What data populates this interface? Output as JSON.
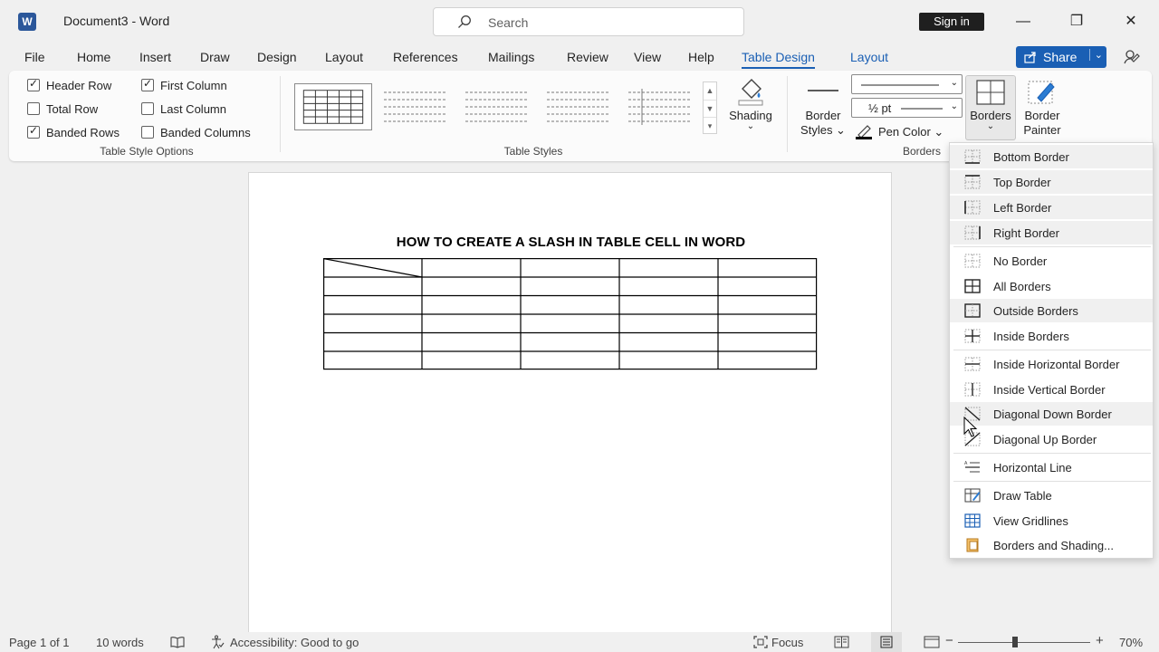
{
  "titlebar": {
    "app_icon": "W",
    "title": "Document3  -  Word",
    "search_placeholder": "Search",
    "sign_in": "Sign in",
    "minimize": "—",
    "restore": "❐",
    "close": "✕"
  },
  "tabs": [
    {
      "label": "File"
    },
    {
      "label": "Home"
    },
    {
      "label": "Insert"
    },
    {
      "label": "Draw"
    },
    {
      "label": "Design"
    },
    {
      "label": "Layout"
    },
    {
      "label": "References"
    },
    {
      "label": "Mailings"
    },
    {
      "label": "Review"
    },
    {
      "label": "View"
    },
    {
      "label": "Help"
    },
    {
      "label": "Table Design"
    },
    {
      "label": "Layout"
    }
  ],
  "share": {
    "label": "Share",
    "caret": "⌄"
  },
  "ribbon": {
    "style_options": {
      "header_row": "Header Row",
      "first_column": "First Column",
      "total_row": "Total Row",
      "last_column": "Last Column",
      "banded_rows": "Banded Rows",
      "banded_columns": "Banded Columns",
      "group_label": "Table Style Options"
    },
    "table_styles_label": "Table Styles",
    "shading": {
      "label": "Shading",
      "caret": "⌄"
    },
    "border_styles": {
      "line1": "Border",
      "line2": "Styles ⌄"
    },
    "pen_weight": "½ pt",
    "pen_color": "Pen Color ⌄",
    "borders_btn": {
      "label": "Borders",
      "caret": "⌄"
    },
    "border_painter": {
      "line1": "Border",
      "line2": "Painter"
    },
    "borders_group_label": "Borders"
  },
  "document": {
    "heading": "HOW TO CREATE A SLASH IN TABLE CELL IN WORD",
    "table": {
      "rows": 6,
      "cols": 5,
      "diagonal_cell": "row 1 col 1"
    }
  },
  "borders_menu": [
    {
      "label": "Bottom Border",
      "icon": "bottom-border-icon"
    },
    {
      "label": "Top Border",
      "icon": "top-border-icon"
    },
    {
      "label": "Left Border",
      "icon": "left-border-icon"
    },
    {
      "label": "Right Border",
      "icon": "right-border-icon"
    },
    {
      "label": "No Border",
      "icon": "no-border-icon"
    },
    {
      "label": "All Borders",
      "icon": "all-borders-icon"
    },
    {
      "label": "Outside Borders",
      "icon": "outside-borders-icon"
    },
    {
      "label": "Inside Borders",
      "icon": "inside-borders-icon"
    },
    {
      "label": "Inside Horizontal Border",
      "icon": "inside-horizontal-border-icon"
    },
    {
      "label": "Inside Vertical Border",
      "icon": "inside-vertical-border-icon"
    },
    {
      "label": "Diagonal Down Border",
      "icon": "diagonal-down-border-icon"
    },
    {
      "label": "Diagonal Up Border",
      "icon": "diagonal-up-border-icon"
    },
    {
      "label": "Horizontal Line",
      "icon": "horizontal-line-icon"
    },
    {
      "label": "Draw Table",
      "icon": "draw-table-icon"
    },
    {
      "label": "View Gridlines",
      "icon": "view-gridlines-icon"
    },
    {
      "label": "Borders and Shading...",
      "icon": "borders-and-shading-icon"
    }
  ],
  "statusbar": {
    "page": "Page 1 of 1",
    "words": "10 words",
    "accessibility": "Accessibility: Good to go",
    "focus": "Focus",
    "zoom_minus": "−",
    "zoom_plus": "+",
    "zoom": "70%"
  }
}
